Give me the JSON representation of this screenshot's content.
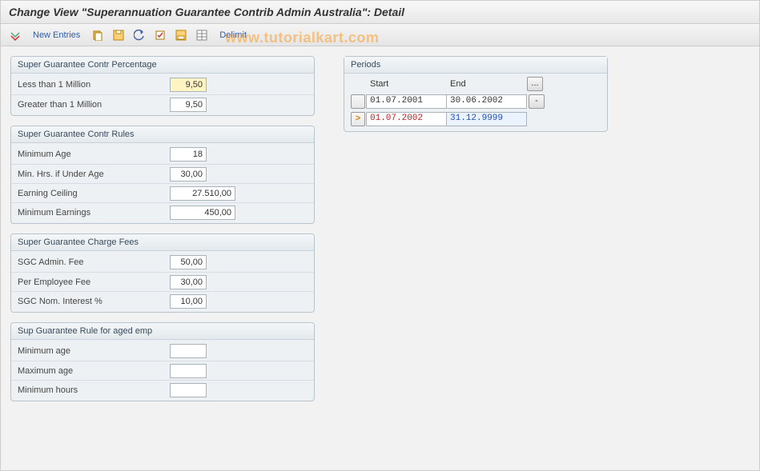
{
  "title": "Change View \"Superannuation Guarantee Contrib Admin Australia\": Detail",
  "toolbar": {
    "new_entries": "New Entries",
    "delimit": "Delimit"
  },
  "watermark": "www.tutorialkart.com",
  "groups": {
    "percentage": {
      "title": "Super Guarantee Contr Percentage",
      "less_label": "Less than 1 Million",
      "less_value": "9,50",
      "greater_label": "Greater than 1 Million",
      "greater_value": "9,50"
    },
    "rules": {
      "title": "Super Guarantee Contr Rules",
      "min_age_label": "Minimum Age",
      "min_age_value": "18",
      "min_hrs_label": "Min. Hrs. if Under Age",
      "min_hrs_value": "30,00",
      "ceiling_label": "Earning Ceiling",
      "ceiling_value": "27.510,00",
      "min_earn_label": "Minimum Earnings",
      "min_earn_value": "450,00"
    },
    "fees": {
      "title": "Super Guarantee Charge Fees",
      "admin_label": "SGC Admin. Fee",
      "admin_value": "50,00",
      "peremp_label": "Per Employee Fee",
      "peremp_value": "30,00",
      "nomint_label": "SGC Nom. Interest %",
      "nomint_value": "10,00"
    },
    "aged": {
      "title": "Sup Guarantee Rule for aged emp",
      "min_age_label": "Minimum age",
      "min_age_value": "",
      "max_age_label": "Maximum age",
      "max_age_value": "",
      "min_hrs_label": "Minimum hours",
      "min_hrs_value": ""
    }
  },
  "periods": {
    "title": "Periods",
    "start_header": "Start",
    "end_header": "End",
    "expand_btn": "...",
    "rows": [
      {
        "selector": "",
        "start": "01.07.2001",
        "end": "30.06.2002",
        "action": "-",
        "active": false
      },
      {
        "selector": ">",
        "start": "01.07.2002",
        "end": "31.12.9999",
        "action": "",
        "active": true
      }
    ]
  }
}
